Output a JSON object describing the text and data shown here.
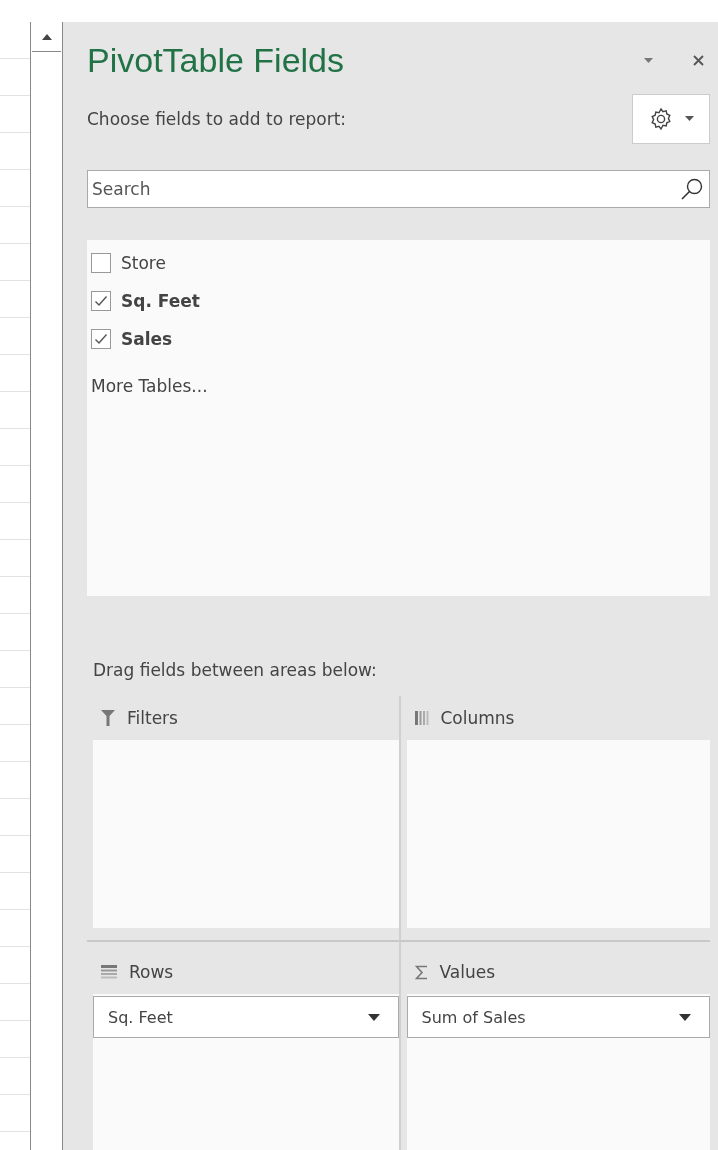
{
  "panel": {
    "title": "PivotTable Fields",
    "choose_label": "Choose fields to add to report:",
    "search": {
      "placeholder": "Search"
    },
    "fields": [
      {
        "label": "Store",
        "checked": false
      },
      {
        "label": "Sq. Feet",
        "checked": true
      },
      {
        "label": "Sales",
        "checked": true
      }
    ],
    "more_tables": "More Tables...",
    "drag_label": "Drag fields between areas below:",
    "areas": [
      {
        "kind": "filters",
        "label": "Filters"
      },
      {
        "kind": "columns",
        "label": "Columns"
      },
      {
        "kind": "rows",
        "label": "Rows",
        "items": [
          "Sq. Feet"
        ]
      },
      {
        "kind": "values",
        "label": "Values",
        "items": [
          "Sum of Sales"
        ]
      }
    ]
  }
}
